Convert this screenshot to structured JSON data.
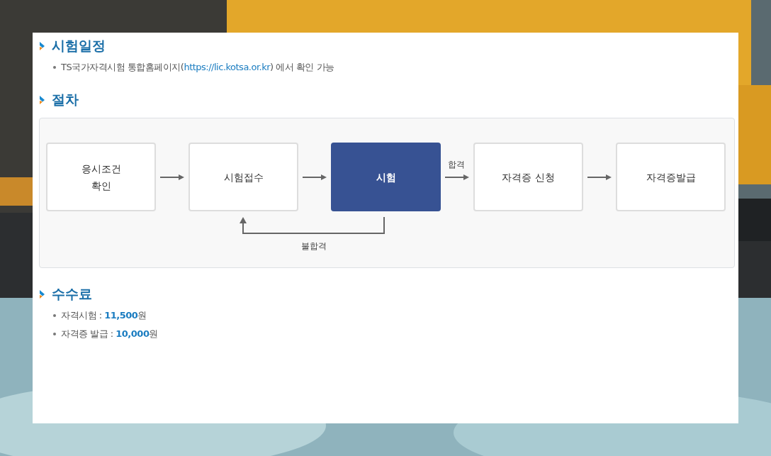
{
  "sections": [
    {
      "kind": "bullets",
      "title": "시험일정",
      "items": [
        {
          "prefix": "TS국가자격시험 통합홈페이지(",
          "link": "https://lic.kotsa.or.kr",
          "suffix": ") 에서 확인 가능"
        }
      ]
    },
    {
      "kind": "flow",
      "title": "절차",
      "steps": [
        {
          "label": "응시조건\n확인",
          "highlighted": false
        },
        {
          "label": "시험접수",
          "highlighted": false
        },
        {
          "label": "시험",
          "highlighted": true
        },
        {
          "label": "자격증 신청",
          "highlighted": false
        },
        {
          "label": "자격증발급",
          "highlighted": false
        }
      ],
      "pass_label": "합격",
      "fail_label": "불합격"
    },
    {
      "kind": "fees",
      "title": "수수료",
      "items": [
        {
          "label": "자격시험 :",
          "amount": "11,500",
          "unit": "원"
        },
        {
          "label": "자격증 발급 :",
          "amount": "10,000",
          "unit": "원"
        }
      ]
    }
  ]
}
